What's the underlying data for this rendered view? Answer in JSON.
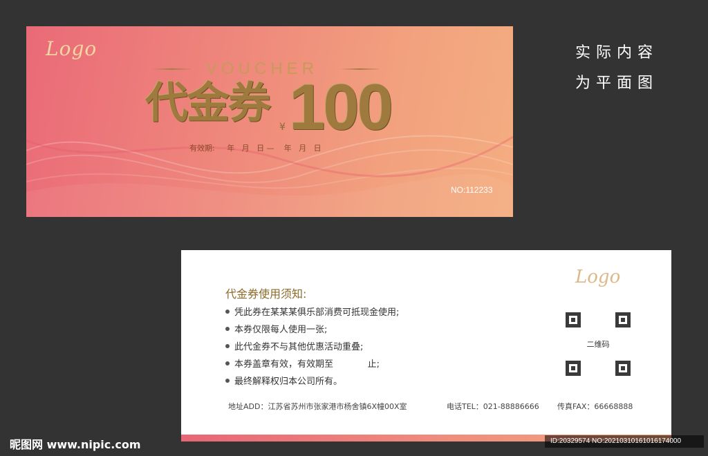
{
  "front": {
    "logo": "Logo",
    "voucher_word": "VOUCHER",
    "title": "代金券",
    "currency_symbol": "¥",
    "amount": "100",
    "valid_period": "有效期:     年   月   日 —    年   月   日",
    "serial": "NO:112233"
  },
  "side_note": {
    "line1": "实际内容",
    "line2": "为平面图"
  },
  "back": {
    "logo": "Logo",
    "rules_title": "代金券使用须知:",
    "rules": [
      "凭此券在某某某俱乐部消费可抵现金使用;",
      "本券仅限每人使用一张;",
      "此代金券不与其他优惠活动重叠;",
      "本券盖章有效，有效期至            止;",
      "最终解释权归本公司所有。"
    ],
    "qr_label": "二维码",
    "address": "地址ADD：江苏省苏州市张家港市杨舍镇6X幢00X室",
    "tel": "电话TEL：021-88886666",
    "fax": "传真FAX：66668888"
  },
  "watermark": {
    "site": "昵图网 www.nipic.com",
    "id": "ID:20329574 NO:20210310161016174000"
  },
  "colors": {
    "background": "#333333",
    "front_gradient_start": "#ea6a78",
    "front_gradient_end": "#f4ad80",
    "gold": "#9e7a3e",
    "rules_title": "#8b6a2a"
  }
}
